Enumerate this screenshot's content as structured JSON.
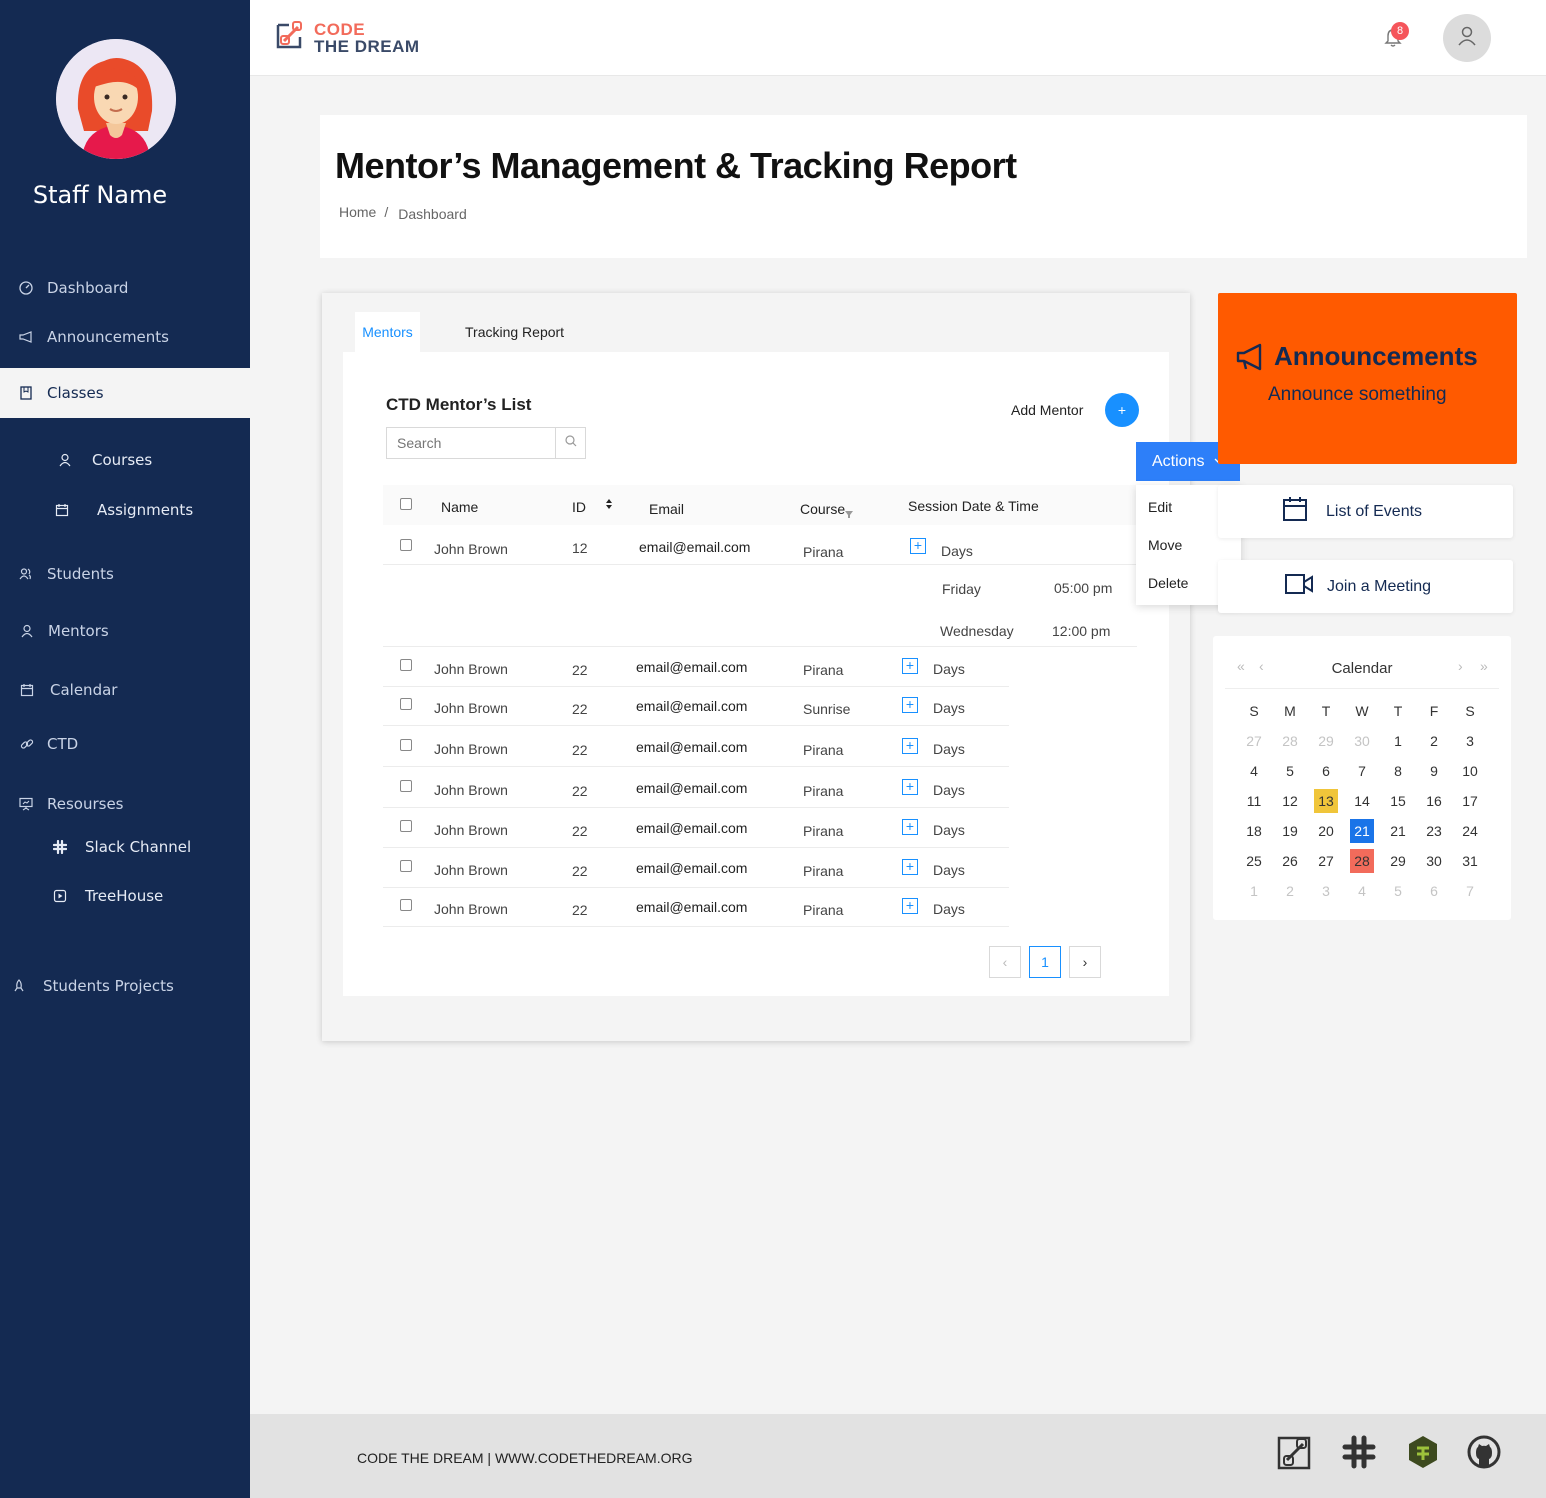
{
  "sidebar": {
    "staff_name": "Staff Name",
    "items": [
      {
        "label": "Dashboard"
      },
      {
        "label": "Announcements"
      },
      {
        "label": "Classes"
      },
      {
        "label": "Courses"
      },
      {
        "label": "Assignments"
      },
      {
        "label": "Students"
      },
      {
        "label": "Mentors"
      },
      {
        "label": "Calendar"
      },
      {
        "label": "CTD"
      },
      {
        "label": "Resourses"
      },
      {
        "label": "Slack Channel"
      },
      {
        "label": "TreeHouse"
      },
      {
        "label": "Students Projects"
      }
    ]
  },
  "header": {
    "logo_line1": "CODE",
    "logo_line2": "THE DREAM",
    "notification_count": "8"
  },
  "page": {
    "title": "Mentor’s Management & Tracking Report",
    "breadcrumb": [
      "Home",
      "/",
      "Dashboard"
    ]
  },
  "tabs": [
    {
      "label": "Mentors"
    },
    {
      "label": "Tracking Report"
    }
  ],
  "mentor_list": {
    "title": "CTD Mentor’s List",
    "search_placeholder": "Search",
    "add_label": "Add Mentor",
    "add_button": "+",
    "columns": [
      "Name",
      "ID",
      "Email",
      "Course",
      "Session Date & Time"
    ],
    "rows": [
      {
        "name": "John Brown",
        "id": "12",
        "email": "email@email.com",
        "course": "Pirana",
        "days": "Days"
      },
      {
        "name": "John Brown",
        "id": "22",
        "email": "email@email.com",
        "course": "Pirana",
        "days": "Days"
      },
      {
        "name": "John Brown",
        "id": "22",
        "email": "email@email.com",
        "course": "Sunrise",
        "days": "Days"
      },
      {
        "name": "John Brown",
        "id": "22",
        "email": "email@email.com",
        "course": "Pirana",
        "days": "Days"
      },
      {
        "name": "John Brown",
        "id": "22",
        "email": "email@email.com",
        "course": "Pirana",
        "days": "Days"
      },
      {
        "name": "John Brown",
        "id": "22",
        "email": "email@email.com",
        "course": "Pirana",
        "days": "Days"
      },
      {
        "name": "John Brown",
        "id": "22",
        "email": "email@email.com",
        "course": "Pirana",
        "days": "Days"
      },
      {
        "name": "John Brown",
        "id": "22",
        "email": "email@email.com",
        "course": "Pirana",
        "days": "Days"
      }
    ],
    "expanded_sessions": [
      {
        "day": "Friday",
        "time": "05:00 pm"
      },
      {
        "day": "Wednesday",
        "time": "12:00 pm"
      }
    ],
    "pagination": {
      "current": "1"
    }
  },
  "actions": {
    "label": "Actions",
    "items": [
      "Edit",
      "Move",
      "Delete"
    ]
  },
  "announcements_card": {
    "title": "Announcements",
    "subtitle": "Announce something"
  },
  "side_buttons": {
    "events": "List of Events",
    "meeting": "Join a Meeting"
  },
  "calendar": {
    "title": "Calendar",
    "weekdays": [
      "S",
      "M",
      "T",
      "W",
      "T",
      "F",
      "S"
    ],
    "weeks": [
      [
        "27",
        "28",
        "29",
        "30",
        "1",
        "2",
        "3"
      ],
      [
        "4",
        "5",
        "6",
        "7",
        "8",
        "9",
        "10"
      ],
      [
        "11",
        "12",
        "13",
        "14",
        "15",
        "16",
        "17"
      ],
      [
        "18",
        "19",
        "20",
        "21",
        "21",
        "23",
        "24"
      ],
      [
        "25",
        "26",
        "27",
        "28",
        "29",
        "30",
        "31"
      ],
      [
        "1",
        "2",
        "3",
        "4",
        "5",
        "6",
        "7"
      ]
    ],
    "highlights": {
      "yellow": "13",
      "blue": "21",
      "red": "28"
    },
    "colors": {
      "yellow": "#f0c53a",
      "blue": "#1a74e8",
      "red": "#f26b5b"
    }
  },
  "footer": {
    "text": "CODE THE DREAM | WWW.CODETHEDREAM.ORG",
    "icons": [
      "ctd-logo-icon",
      "slack-icon",
      "treehouse-icon",
      "github-icon"
    ]
  },
  "colors": {
    "sidebar": "#142a52",
    "accent": "#1890ff",
    "announcement": "#ff5a00",
    "brand_orange": "#f26b5b"
  }
}
